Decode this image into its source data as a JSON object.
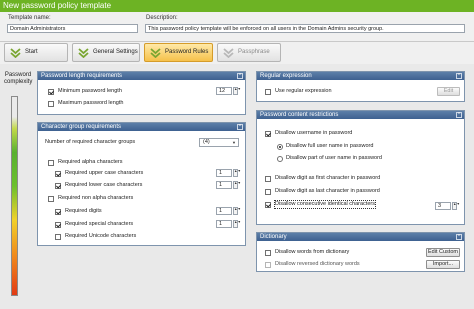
{
  "window": {
    "title": "New password policy template"
  },
  "fields": {
    "template_name_label": "Template name:",
    "template_name_value": "Domain Administrators",
    "description_label": "Description:",
    "description_value": "This password policy template will be enforced on all users in the Domain Admins security group."
  },
  "tabs": [
    {
      "label": "Start"
    },
    {
      "label": "General Settings"
    },
    {
      "label": "Password Rules"
    },
    {
      "label": "Passphrase"
    }
  ],
  "complexity": {
    "label_line1": "Password",
    "label_line2": "complexity"
  },
  "length_panel": {
    "title": "Password length requirements",
    "min_label": "Minimum password length",
    "min_value": "12",
    "max_label": "Maximum password length"
  },
  "groups_panel": {
    "title": "Character group requirements",
    "num_groups_label": "Number of required character groups",
    "num_groups_value": "(4)",
    "alpha_label": "Required alpha characters",
    "upper_label": "Required upper case characters",
    "upper_value": "1",
    "lower_label": "Required lower case characters",
    "lower_value": "1",
    "nonalpha_label": "Required non alpha characters",
    "digits_label": "Required digits",
    "digits_value": "1",
    "special_label": "Required special characters",
    "special_value": "1",
    "unicode_label": "Required Unicode characters"
  },
  "regex_panel": {
    "title": "Regular expression",
    "use_label": "Use regular expression",
    "edit_label": "Edit"
  },
  "restrictions_panel": {
    "title": "Password content restrictions",
    "disallow_username": "Disallow username in password",
    "disallow_full": "Disallow full user name in password",
    "disallow_part": "Disallow part of user name in password",
    "disallow_digit_first": "Disallow digit as first character in password",
    "disallow_digit_last": "Disallow digit as last character in password",
    "disallow_consecutive": "Disallow consecutive identical characters",
    "consecutive_value": "3"
  },
  "dictionary_panel": {
    "title": "Dictionary",
    "disallow_words": "Disallow words from dictionary",
    "disallow_reversed": "Disallow reversed dictionary words",
    "edit_custom_label": "Edit Custom",
    "import_label": "Import..."
  },
  "colors": {
    "title_bar": "#6db324",
    "panel_header": "#4a6d9a",
    "active_tab": "#f6c14b"
  }
}
